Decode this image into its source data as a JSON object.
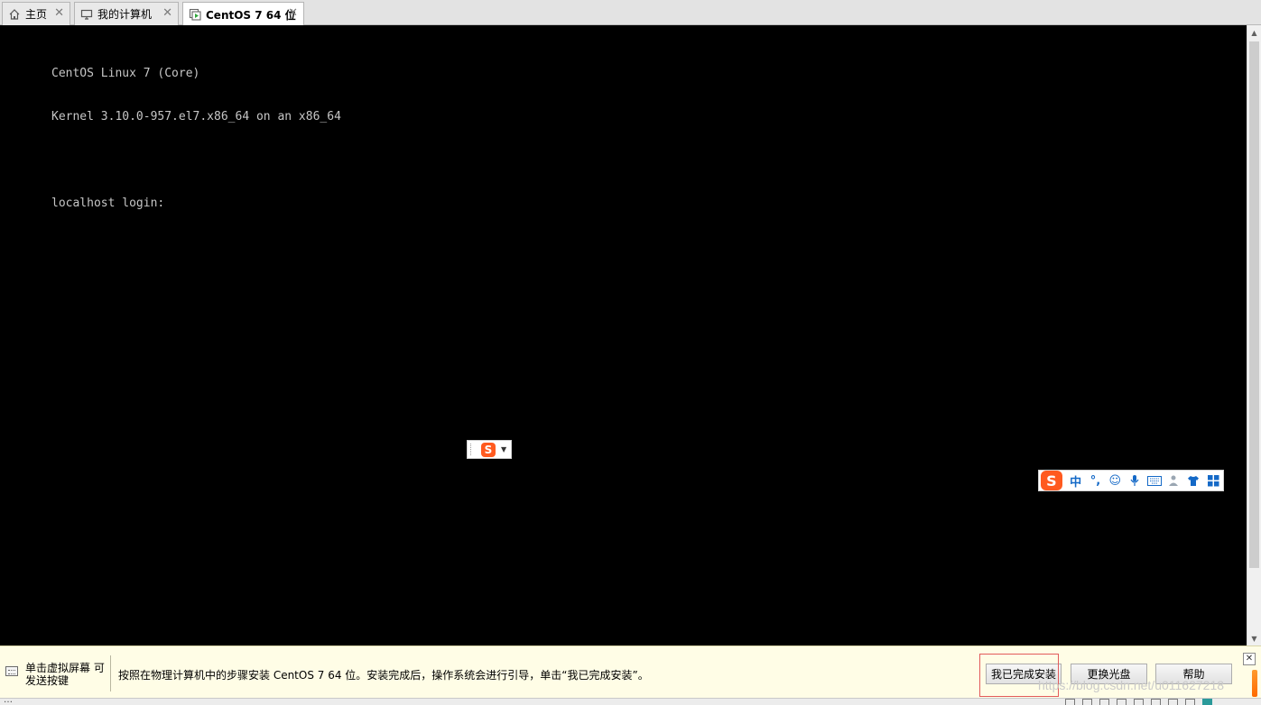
{
  "tabs": [
    {
      "label": "主页",
      "icon": "home-icon"
    },
    {
      "label": "我的计算机",
      "icon": "monitor-icon"
    },
    {
      "label": "CentOS 7 64 位",
      "icon": "vm-running-icon",
      "active": true
    }
  ],
  "tab_close_glyph": "✕",
  "console": {
    "lines": [
      "CentOS Linux 7 (Core)",
      "Kernel 3.10.0-957.el7.x86_64 on an x86_64",
      "",
      "localhost login:"
    ]
  },
  "ime": {
    "mini_logo": "S",
    "bar_logo": "S",
    "bar_items": [
      {
        "icon": "chinese-mode-icon",
        "glyph": "中"
      },
      {
        "icon": "punctuation-icon",
        "glyph": "°,"
      },
      {
        "icon": "emoji-icon",
        "glyph": "☺"
      },
      {
        "icon": "microphone-icon",
        "glyph": "🎤"
      },
      {
        "icon": "keyboard-icon",
        "glyph": "⌨"
      },
      {
        "icon": "user-icon",
        "glyph": "👤"
      },
      {
        "icon": "skin-shirt-icon",
        "glyph": "👕"
      },
      {
        "icon": "toolbox-grid-icon",
        "glyph": "▦"
      }
    ]
  },
  "notification": {
    "hint": "单击虚拟屏幕 可发送按键",
    "message": "按照在物理计算机中的步骤安装 CentOS 7 64 位。安装完成后，操作系统会进行引导，单击“我已完成安装”。",
    "buttons": {
      "done": "我已完成安装",
      "change_disc": "更换光盘",
      "help": "帮助"
    }
  },
  "status_text": "…",
  "watermark": "https://blog.csdn.net/u011627218",
  "colors": {
    "console_bg": "#000000",
    "console_text": "#c6c6c6",
    "notification_bg": "#fffde6",
    "highlight_border": "#e25b5b",
    "sogou_orange": "#ff5a1f"
  }
}
